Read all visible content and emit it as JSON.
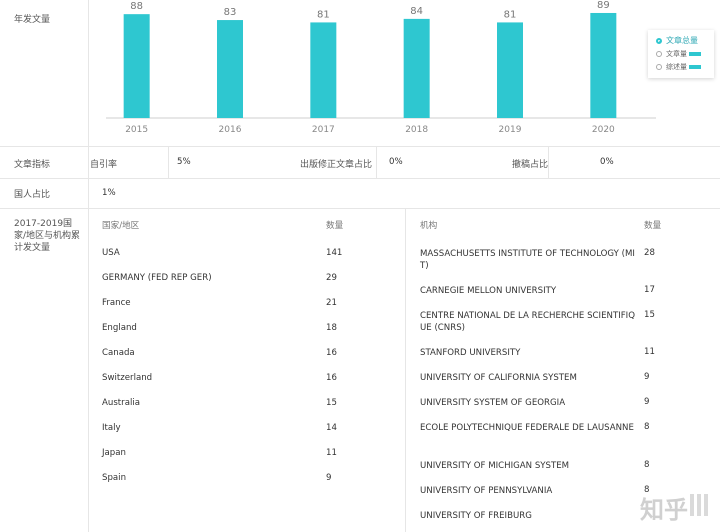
{
  "sections": {
    "annual_label": "年发文量",
    "indicator_label": "文章指标",
    "domestic_label": "国人占比",
    "collab_label": "2017-2019国家/地区与机构累计发文量"
  },
  "chart_data": {
    "type": "bar",
    "categories": [
      "2015",
      "2016",
      "2017",
      "2018",
      "2019",
      "2020"
    ],
    "values": [
      88,
      83,
      81,
      84,
      81,
      89
    ],
    "ylim": [
      0,
      100
    ],
    "legend_position": "right",
    "legend": [
      {
        "label": "文章总量",
        "color": "#2ec7d0",
        "style": "radio-selected"
      },
      {
        "label": "文章量",
        "color": "#2ec7d0",
        "style": "radio-bar"
      },
      {
        "label": "综述量",
        "color": "#2ec7d0",
        "style": "radio-bar"
      }
    ],
    "colors": {
      "bar": "#2ec7d0",
      "axis": "#cfcfcf",
      "label": "#777777"
    }
  },
  "indicators": [
    {
      "label": "自引率",
      "value": "5%"
    },
    {
      "label": "出版修正文章占比",
      "value": "0%"
    },
    {
      "label": "撤稿占比",
      "value": "0%"
    }
  ],
  "domestic_value": "1%",
  "countries": {
    "headers": [
      "国家/地区",
      "数量"
    ],
    "rows": [
      [
        "USA",
        "141"
      ],
      [
        "GERMANY (FED REP GER)",
        "29"
      ],
      [
        "France",
        "21"
      ],
      [
        "England",
        "18"
      ],
      [
        "Canada",
        "16"
      ],
      [
        "Switzerland",
        "16"
      ],
      [
        "Australia",
        "15"
      ],
      [
        "Italy",
        "14"
      ],
      [
        "Japan",
        "11"
      ],
      [
        "Spain",
        "9"
      ]
    ]
  },
  "institutions": {
    "headers": [
      "机构",
      "数量"
    ],
    "rows": [
      [
        "MASSACHUSETTS INSTITUTE OF TECHNOLOGY (MIT)",
        "28"
      ],
      [
        "CARNEGIE MELLON UNIVERSITY",
        "17"
      ],
      [
        "CENTRE NATIONAL DE LA RECHERCHE SCIENTIFIQUE (CNRS)",
        "15"
      ],
      [
        "STANFORD UNIVERSITY",
        "11"
      ],
      [
        "UNIVERSITY OF CALIFORNIA SYSTEM",
        "9"
      ],
      [
        "UNIVERSITY SYSTEM OF GEORGIA",
        "9"
      ],
      [
        "ECOLE POLYTECHNIQUE FEDERALE DE LAUSANNE",
        "8"
      ],
      [
        "UNIVERSITY OF MICHIGAN SYSTEM",
        "8"
      ],
      [
        "UNIVERSITY OF PENNSYLVANIA",
        "8"
      ],
      [
        "UNIVERSITY OF FREIBURG",
        ""
      ]
    ]
  },
  "watermark": "知乎"
}
